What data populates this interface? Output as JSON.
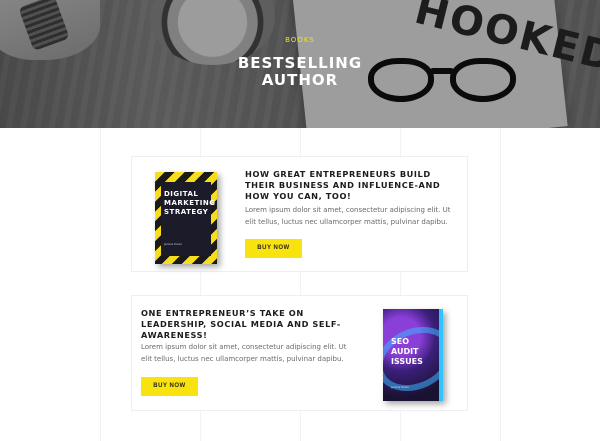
{
  "hero": {
    "kicker": "BOOKS",
    "title_line1": "BESTSELLING",
    "title_line2": "AUTHOR"
  },
  "books": [
    {
      "title": "HOW GREAT ENTREPRENEURS BUILD THEIR BUSINESS AND INFLUENCE-AND HOW YOU CAN, TOO!",
      "description": "Lorem ipsum dolor sit amet, consectetur adipiscing elit. Ut elit tellus, luctus nec ullamcorper mattis, pulvinar dapibu.",
      "button_label": "BUY NOW",
      "cover_title": "DIGITAL MARKETING STRATEGY",
      "cover_author": "Janine Doen"
    },
    {
      "title": "ONE ENTREPRENEUR’S TAKE ON LEADERSHIP, SOCIAL MEDIA AND SELF-AWARENESS!",
      "description": "Lorem ipsum dolor sit amet, consectetur adipiscing elit. Ut elit tellus, luctus nec ullamcorper mattis, pulvinar dapibu.",
      "button_label": "BUY NOW",
      "cover_title": "SEO AUDIT ISSUES",
      "cover_author": "Janine Doen"
    }
  ],
  "colors": {
    "accent": "#f9e30f",
    "heading": "#1c1c1c",
    "body_text": "#6a6a6a"
  },
  "icons": {
    "hero_image": "desk-with-coffee-glasses-book-photo"
  }
}
